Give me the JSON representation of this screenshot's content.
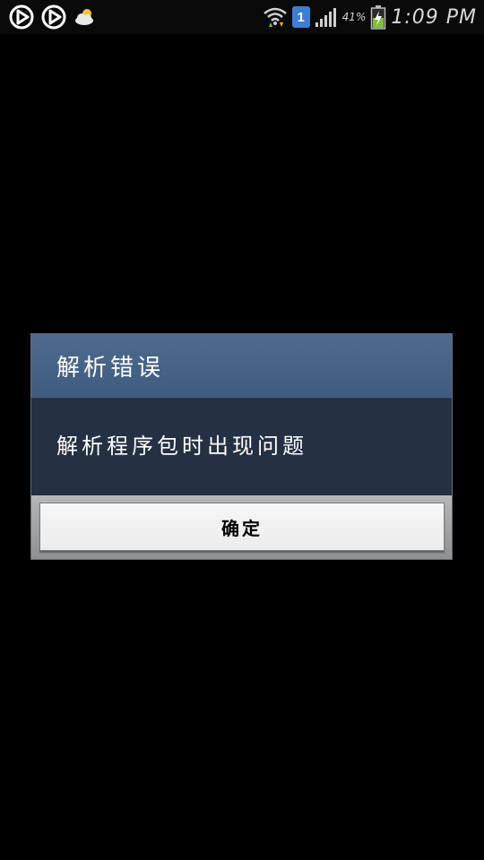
{
  "status_bar": {
    "time": "1:09 PM",
    "battery_percent": "41%",
    "notification_count": "1",
    "icons": [
      "play-store-icon",
      "play-store-icon",
      "weather-icon",
      "wifi-icon",
      "notification-badge-icon",
      "signal-icon",
      "battery-charging-icon"
    ],
    "colors": {
      "battery_fill": "#7ac230",
      "badge": "#3a7fd0"
    }
  },
  "dialog": {
    "title": "解析错误",
    "message": "解析程序包时出现问题",
    "ok_label": "确定",
    "colors": {
      "title_bar": "#46648a",
      "body": "#233142",
      "button": "#f2f2f2"
    }
  }
}
